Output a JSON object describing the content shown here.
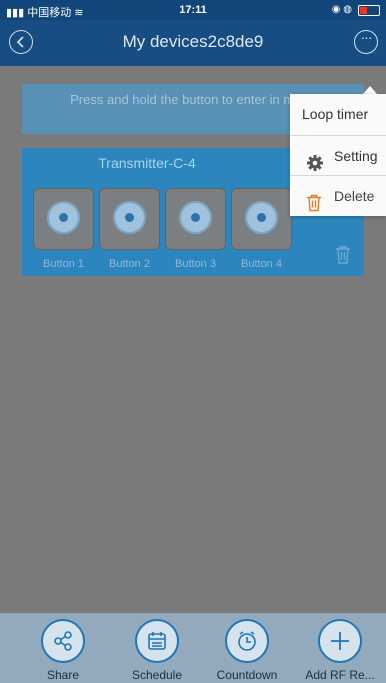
{
  "status": {
    "carrier": "中国移动",
    "time": "17:11"
  },
  "header": {
    "title": "My devices2c8de9"
  },
  "hint": "Press and hold the button to enter in mode",
  "device": {
    "name": "Transmitter-C-4",
    "buttons": [
      {
        "label": "Button 1"
      },
      {
        "label": "Button 2"
      },
      {
        "label": "Button 3"
      },
      {
        "label": "Button 4"
      }
    ]
  },
  "menu": {
    "items": [
      {
        "label": "Loop timer",
        "icon": "none"
      },
      {
        "label": "Setting",
        "icon": "gear-icon"
      },
      {
        "label": "Delete",
        "icon": "trash-icon"
      }
    ]
  },
  "footer": {
    "items": [
      {
        "label": "Share",
        "icon": "share-icon"
      },
      {
        "label": "Schedule",
        "icon": "calendar-icon"
      },
      {
        "label": "Countdown",
        "icon": "clock-icon"
      },
      {
        "label": "Add RF Re...",
        "icon": "plus-icon"
      }
    ]
  },
  "colors": {
    "header_bg": "#174d83",
    "card_bg": "#2c86bd",
    "accent": "#1f76b8",
    "delete_orange": "#e97a2a"
  }
}
